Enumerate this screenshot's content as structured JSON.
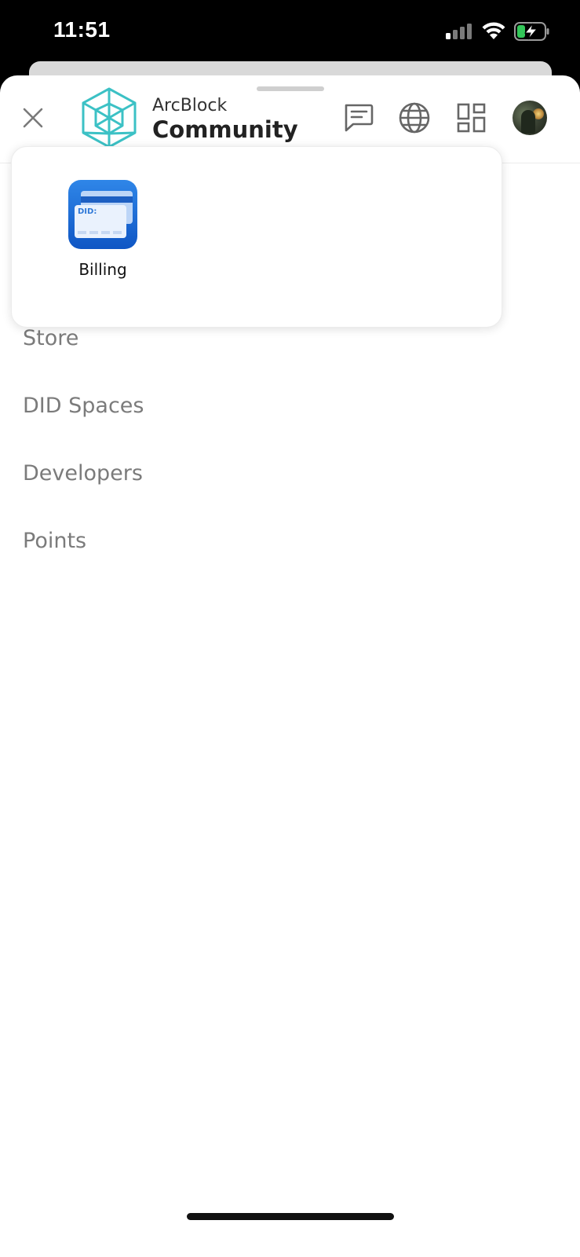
{
  "status_bar": {
    "time": "11:51",
    "signal_bars_active": 1,
    "battery_charging": true
  },
  "header": {
    "brand_top": "ArcBlock",
    "brand_bottom": "Community",
    "accent_color": "#3cc1c5",
    "icons": [
      "close-icon",
      "message-icon",
      "globe-icon",
      "apps-grid-icon",
      "avatar"
    ]
  },
  "app_popup": {
    "apps": [
      {
        "label": "Billing",
        "icon_text": "DID:"
      }
    ]
  },
  "nav": {
    "items": [
      "Store",
      "DID Spaces",
      "Developers",
      "Points"
    ]
  }
}
